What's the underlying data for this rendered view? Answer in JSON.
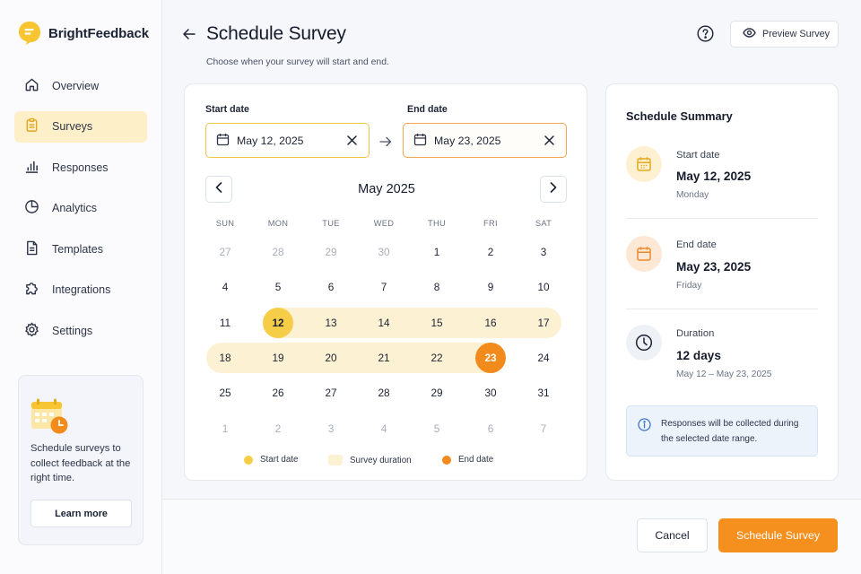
{
  "app": {
    "name": "BrightFeedback"
  },
  "sidebar": {
    "items": [
      {
        "label": "Overview",
        "icon": "home-icon"
      },
      {
        "label": "Surveys",
        "icon": "clipboard-icon",
        "active": true
      },
      {
        "label": "Responses",
        "icon": "bar-chart-icon"
      },
      {
        "label": "Analytics",
        "icon": "pie-chart-icon"
      },
      {
        "label": "Templates",
        "icon": "document-icon"
      },
      {
        "label": "Integrations",
        "icon": "puzzle-icon"
      },
      {
        "label": "Settings",
        "icon": "gear-icon"
      }
    ],
    "promo": {
      "text": "Schedule surveys to collect feedback at the right time.",
      "button": "Learn more"
    }
  },
  "header": {
    "title": "Schedule Survey",
    "subtitle": "Choose when your survey will start and end.",
    "preview_button": "Preview Survey"
  },
  "calendar": {
    "start_label": "Start date",
    "end_label": "End date",
    "start_value": "May 12, 2025",
    "end_value": "May 23, 2025",
    "month": "May 2025",
    "weekdays": [
      "SUN",
      "MON",
      "TUE",
      "WED",
      "THU",
      "FRI",
      "SAT"
    ],
    "weeks": [
      [
        {
          "d": "27",
          "m": true
        },
        {
          "d": "28",
          "m": true
        },
        {
          "d": "29",
          "m": true
        },
        {
          "d": "30",
          "m": true
        },
        {
          "d": "1"
        },
        {
          "d": "2"
        },
        {
          "d": "3"
        }
      ],
      [
        {
          "d": "4"
        },
        {
          "d": "5"
        },
        {
          "d": "6"
        },
        {
          "d": "7"
        },
        {
          "d": "8"
        },
        {
          "d": "9"
        },
        {
          "d": "10"
        }
      ],
      [
        {
          "d": "11"
        },
        {
          "d": "12",
          "start": true
        },
        {
          "d": "13"
        },
        {
          "d": "14"
        },
        {
          "d": "15"
        },
        {
          "d": "16"
        },
        {
          "d": "17"
        }
      ],
      [
        {
          "d": "18"
        },
        {
          "d": "19"
        },
        {
          "d": "20"
        },
        {
          "d": "21"
        },
        {
          "d": "22"
        },
        {
          "d": "23",
          "end": true
        },
        {
          "d": "24"
        }
      ],
      [
        {
          "d": "25"
        },
        {
          "d": "26"
        },
        {
          "d": "27"
        },
        {
          "d": "28"
        },
        {
          "d": "29"
        },
        {
          "d": "30"
        },
        {
          "d": "31"
        }
      ],
      [
        {
          "d": "1",
          "m": true
        },
        {
          "d": "2",
          "m": true
        },
        {
          "d": "3",
          "m": true
        },
        {
          "d": "4",
          "m": true
        },
        {
          "d": "5",
          "m": true
        },
        {
          "d": "6",
          "m": true
        },
        {
          "d": "7",
          "m": true
        }
      ]
    ],
    "legend": {
      "start": "Start date",
      "duration": "Survey duration",
      "end": "End date"
    },
    "colors": {
      "start": "#f6cd47",
      "end": "#f28a1c",
      "range": "#fdf1d4"
    }
  },
  "summary": {
    "title": "Schedule Summary",
    "start": {
      "label": "Start date",
      "value": "May 12, 2025",
      "sub": "Monday"
    },
    "end": {
      "label": "End date",
      "value": "May 23, 2025",
      "sub": "Friday"
    },
    "duration": {
      "label": "Duration",
      "value": "12 days",
      "sub": "May 12 – May 23, 2025"
    },
    "info": "Responses will be collected during the selected date range."
  },
  "footer": {
    "cancel": "Cancel",
    "schedule": "Schedule Survey"
  }
}
